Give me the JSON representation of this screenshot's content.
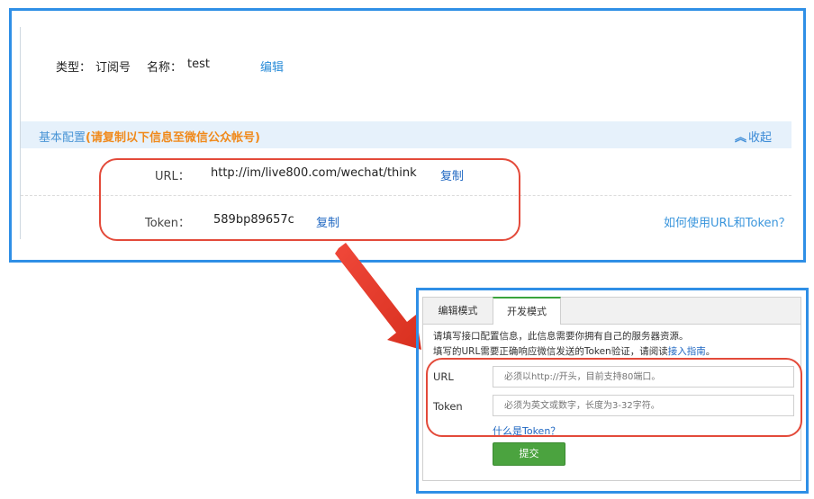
{
  "account": {
    "type_label": "类型：",
    "type_value": "订阅号",
    "name_label": "名称：",
    "name_value": "test",
    "edit_label": "编辑"
  },
  "basic_config": {
    "title": "基本配置",
    "hint": "(请复制以下信息至微信公众帐号)",
    "collapse_label": "收起",
    "url_label": "URL：",
    "url_value": "http://im/live800.com/wechat/think",
    "url_copy": "复制",
    "token_label": "Token：",
    "token_value": "589bp89657c",
    "token_copy": "复制",
    "help_link": "如何使用URL和Token？"
  },
  "dev_panel": {
    "tabs": [
      {
        "label": "编辑模式"
      },
      {
        "label": "开发模式"
      }
    ],
    "info_line1": "请填写接口配置信息，此信息需要你拥有自己的服务器资源。",
    "info_line2_prefix": "填写的URL需要正确响应微信发送的Token验证，请阅读",
    "info_line2_link": "接入指南",
    "info_line2_suffix": "。",
    "url_label": "URL",
    "url_placeholder": "必须以http://开头，目前支持80端口。",
    "token_label": "Token",
    "token_placeholder": "必须为英文或数字，长度为3-32字符。",
    "what_is_token": "什么是Token？",
    "submit_label": "提交"
  },
  "colors": {
    "frame_blue": "#2f8fe6",
    "highlight_red": "#e34a3a",
    "submit_green": "#4ba33f",
    "hint_orange": "#f08a1c",
    "link_blue": "#1f67c2"
  },
  "icons": {
    "collapse": "double-chevron-up-icon",
    "callout": "red-arrow-icon"
  }
}
